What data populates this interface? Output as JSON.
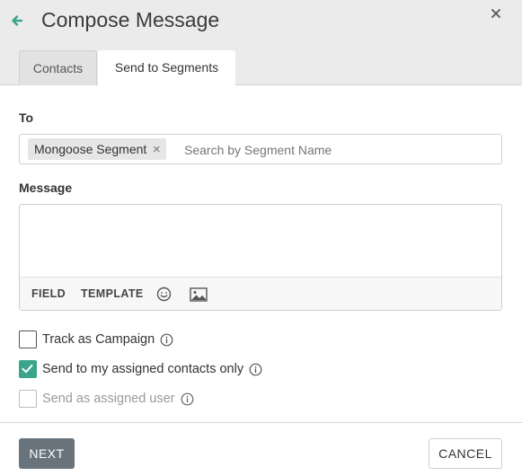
{
  "header": {
    "title": "Compose Message",
    "back_icon": "arrow-left-icon",
    "close_label": "×",
    "accent_color": "#3aa58a"
  },
  "tabs": [
    {
      "label": "Contacts",
      "active": false
    },
    {
      "label": "Send to Segments",
      "active": true
    }
  ],
  "to": {
    "label": "To",
    "chips": [
      {
        "label": "Mongoose Segment",
        "remove_label": "×"
      }
    ],
    "placeholder": "Search by Segment Name"
  },
  "message": {
    "label": "Message",
    "value": "",
    "toolbar": {
      "field_label": "FIELD",
      "template_label": "TEMPLATE",
      "emoji_icon": "smiley-icon",
      "image_icon": "image-icon"
    }
  },
  "options": [
    {
      "label": "Track as Campaign",
      "checked": false,
      "disabled": false
    },
    {
      "label": "Send to my assigned contacts only",
      "checked": true,
      "disabled": false
    },
    {
      "label": "Send as assigned user",
      "checked": false,
      "disabled": true
    }
  ],
  "footer": {
    "next_label": "NEXT",
    "cancel_label": "CANCEL"
  }
}
